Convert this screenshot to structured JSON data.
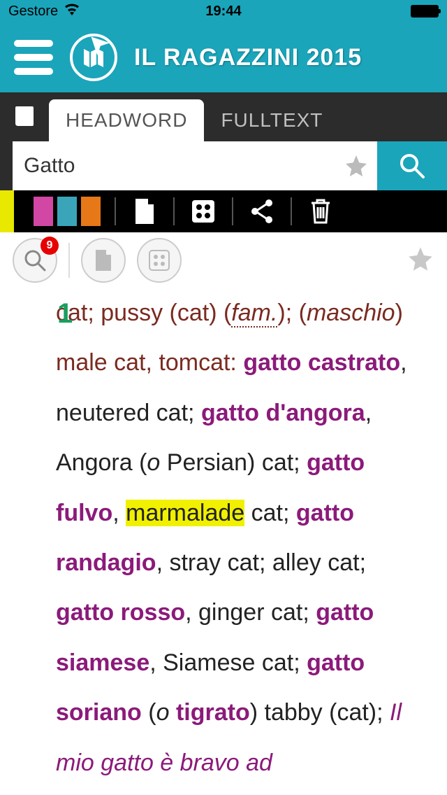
{
  "status": {
    "carrier": "Gestore",
    "time": "19:44"
  },
  "header": {
    "title": "IL RAGAZZINI 2015"
  },
  "tabs": {
    "headword": "HEADWORD",
    "fulltext": "FULLTEXT"
  },
  "search": {
    "value": "Gatto"
  },
  "badge": {
    "count": "9"
  },
  "entry": {
    "sense_num": "1",
    "line1a": "cat; pussy (cat) (",
    "fam": "fam.",
    "line1b": ");",
    "line2a": "(",
    "maschio": "maschio",
    "line2b": ") ",
    "male_cat": "male cat, tomcat:",
    "gc": "gatto castrato",
    "gc_def": ", neutered cat;",
    "gd": "gatto d'angora",
    "gd_def_a": ", Angora (",
    "o1": "o",
    "gd_def_b": " Persian) cat; ",
    "gf": "gatto fulvo",
    "gf_comma": ",",
    "marmalade": "marmalade",
    "marmalade_after": " cat; ",
    "gr": "gatto randagio",
    "gr_def": ", stray cat; alley cat;",
    "gro": "gatto rosso",
    "gro_def": ", ginger cat; ",
    "gs": "gatto siamese",
    "gs_def": ", Siamese cat; ",
    "gso": "gatto soriano",
    "gso_a": " (",
    "o2": "o",
    "tigrato": " tigrato",
    "gso_b": ") tabby (cat); ",
    "example": "Il mio gatto è bravo ad"
  }
}
